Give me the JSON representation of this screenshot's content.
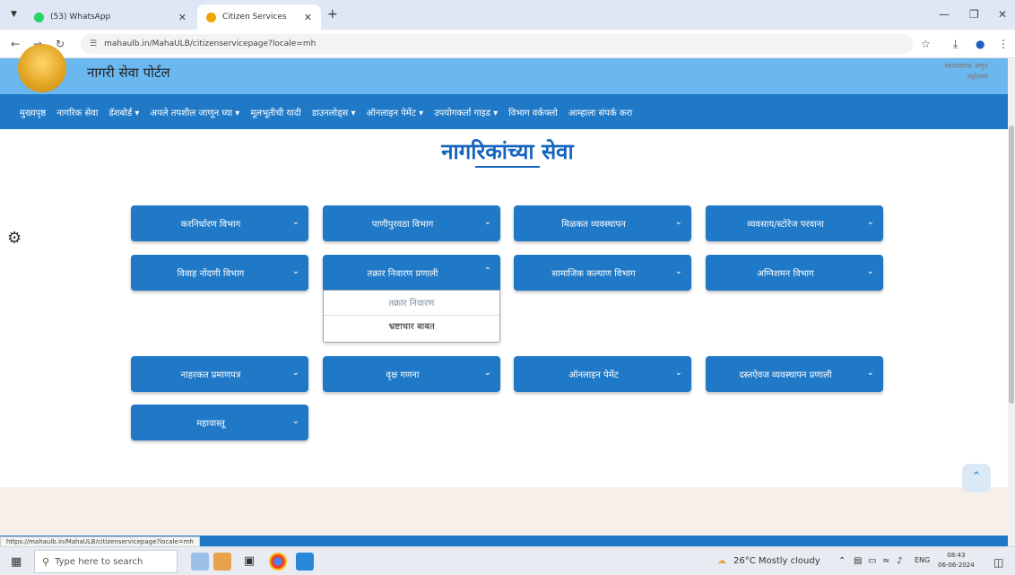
{
  "browser": {
    "tabs": [
      {
        "title": "(53) WhatsApp"
      },
      {
        "title": "Citizen Services"
      }
    ],
    "new_tab_label": "+",
    "url": "mahaulb.in/MahaULB/citizenservicepage?locale=mh",
    "status_url": "https://mahaulb.in/MahaULB/citizenservicepage?locale=mh"
  },
  "site": {
    "portal_name": "नागरी सेवा पोर्टल",
    "azadi_text": "स्वातंत्र्याचा अमृत महोत्सव"
  },
  "nav": {
    "items": [
      "मुख्यपृष्ठ",
      "नागरिक सेवा",
      "डॅशबोर्ड ▾",
      "अपले तपशील जाणून घ्या ▾",
      "मूलभूतीची यादी",
      "डाउनलोड्स ▾",
      "ऑनलाइन पेमेंट ▾",
      "उपयोगकर्ता गाइड ▾",
      "विभाग वर्कफ्लो",
      "आम्हाला संपर्क करा"
    ]
  },
  "page": {
    "title": "नागरिकांच्या सेवा"
  },
  "services": [
    {
      "label": "करनिर्धारण विभाग"
    },
    {
      "label": "पाणीपुरवठा विभाग"
    },
    {
      "label": "मिळकत व्यवस्थापन"
    },
    {
      "label": "व्यवसाय/स्टोरेज परवाना"
    },
    {
      "label": "विवाह नोंदणी विभाग"
    },
    {
      "label": "तक्रार निवारण प्रणाली"
    },
    {
      "label": "सामाजिक कल्याण विभाग"
    },
    {
      "label": "अग्निशमन विभाग"
    },
    {
      "label": "नाहरकत प्रमाणपत्र"
    },
    {
      "label": "वृक्ष गणना"
    },
    {
      "label": "ऑनलाइन पेमेंट"
    },
    {
      "label": "दस्तऐवज व्यवस्थापन प्रणाली"
    },
    {
      "label": "महावास्तू"
    }
  ],
  "dropdown": {
    "items": [
      "तक्रार निवारण",
      "भ्रष्टाचार बाबत"
    ]
  },
  "taskbar": {
    "search_placeholder": "Type here to search",
    "weather": "26°C  Mostly cloudy",
    "language": "ENG",
    "time": "08:43",
    "date": "06-06-2024"
  }
}
